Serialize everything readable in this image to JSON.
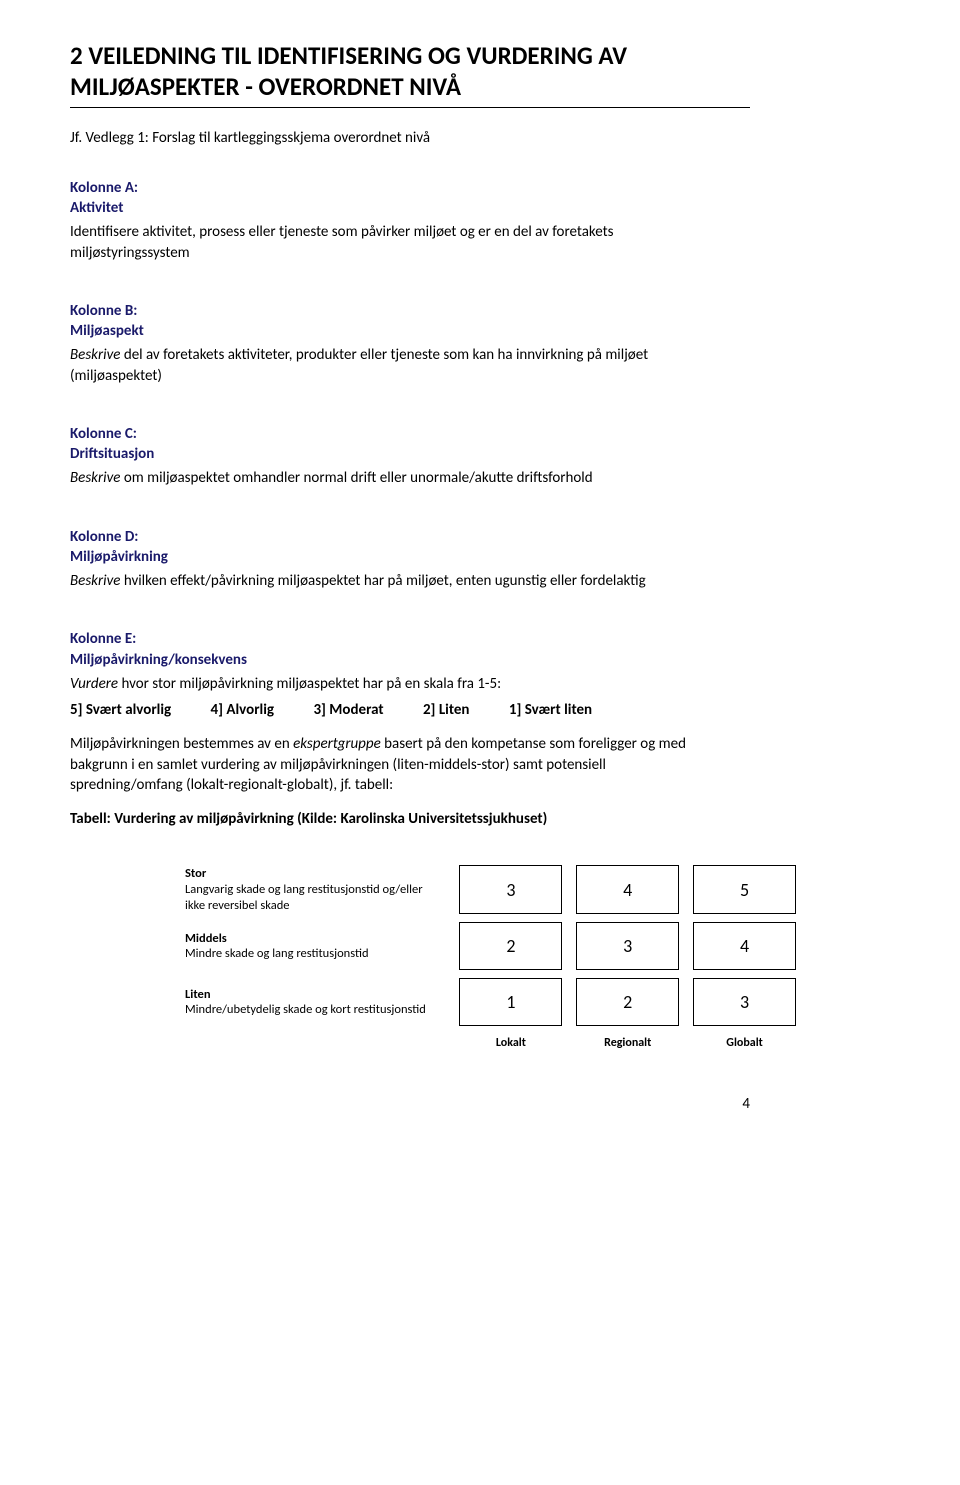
{
  "heading": "2  VEILEDNING TIL IDENTIFISERING OG VURDERING AV MILJØASPEKTER - OVERORDNET NIVÅ",
  "subref": "Jf. Vedlegg 1: Forslag til kartleggingsskjema overordnet nivå",
  "columns": {
    "a": {
      "label": "Kolonne A:",
      "title": "Aktivitet",
      "desc": "Identifisere aktivitet, prosess eller tjeneste som påvirker miljøet og er en del av foretakets miljøstyringssystem"
    },
    "b": {
      "label": "Kolonne B:",
      "title": "Miljøaspekt",
      "desc_prefix": "Beskrive",
      "desc_rest": " del av foretakets aktiviteter, produkter eller tjeneste som kan ha innvirkning på miljøet (miljøaspektet)"
    },
    "c": {
      "label": "Kolonne C:",
      "title": "Driftsituasjon",
      "desc_prefix": "Beskrive",
      "desc_rest": " om miljøaspektet omhandler normal drift eller unormale/akutte driftsforhold"
    },
    "d": {
      "label": "Kolonne D:",
      "title": "Miljøpåvirkning",
      "desc_prefix": "Beskrive",
      "desc_rest": " hvilken effekt/påvirkning miljøaspektet har på miljøet, enten ugunstig eller fordelaktig"
    },
    "e": {
      "label": "Kolonne E:",
      "title": "Miljøpåvirkning/konsekvens",
      "desc1_prefix": "Vurdere",
      "desc1_rest": " hvor stor miljøpåvirkning miljøaspektet har på en skala fra 1-5:",
      "scale": [
        "5] Svært alvorlig",
        "4] Alvorlig",
        "3] Moderat",
        "2] Liten",
        "1] Svært liten"
      ],
      "desc2_part1": "Miljøpåvirkningen bestemmes av en ",
      "desc2_em": "ekspertgruppe",
      "desc2_part2": " basert på den kompetanse som foreligger og med bakgrunn i en samlet vurdering av miljøpåvirkningen (liten-middels-stor) samt potensiell spredning/omfang (lokalt-regionalt-globalt), jf. tabell:",
      "tabtitle": "Tabell: Vurdering av miljøpåvirkning (Kilde: Karolinska Universitetssjukhuset)"
    }
  },
  "matrix": {
    "rows": [
      {
        "title": "Stor",
        "sub": "Langvarig skade og lang restitusjonstid og/eller ikke reversibel skade",
        "cells": [
          "3",
          "4",
          "5"
        ]
      },
      {
        "title": "Middels",
        "sub": "Mindre skade og lang restitusjonstid",
        "cells": [
          "2",
          "3",
          "4"
        ]
      },
      {
        "title": "Liten",
        "sub": "Mindre/ubetydelig skade og kort restitusjonstid",
        "cells": [
          "1",
          "2",
          "3"
        ]
      }
    ],
    "footer": [
      "Lokalt",
      "Regionalt",
      "Globalt"
    ]
  },
  "pagenum": "4"
}
